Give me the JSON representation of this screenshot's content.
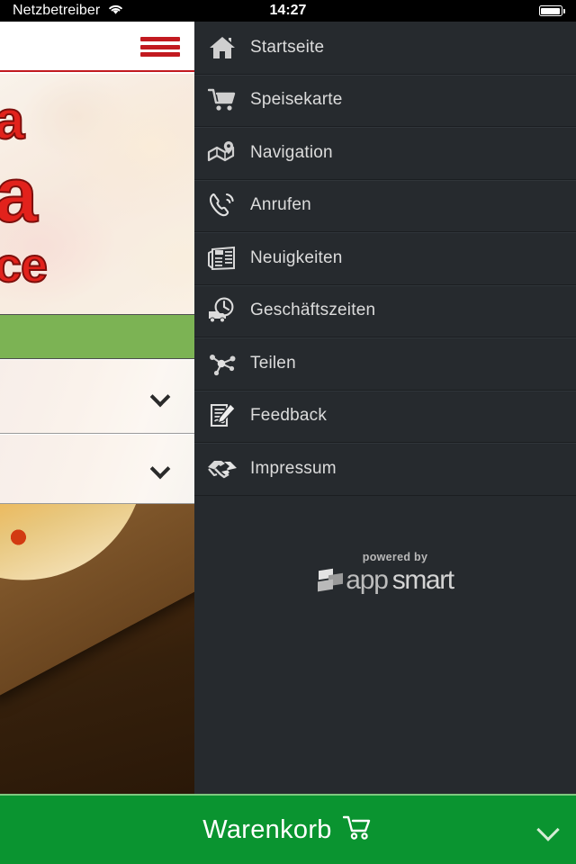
{
  "status_bar": {
    "carrier": "Netzbetreiber",
    "wifi_icon": "wifi-icon",
    "time": "14:27",
    "battery_icon": "battery-full-icon"
  },
  "background_app": {
    "menu_toggle_icon": "hamburger-menu-icon",
    "hero_text_lines": [
      "a",
      "a",
      "ce"
    ],
    "list_rows": [
      {
        "chevron_icon": "chevron-right-icon"
      },
      {
        "chevron_icon": "chevron-right-icon"
      }
    ]
  },
  "drawer": {
    "items": [
      {
        "label": "Startseite",
        "icon": "home-icon"
      },
      {
        "label": "Speisekarte",
        "icon": "shopping-cart-icon"
      },
      {
        "label": "Navigation",
        "icon": "map-pin-icon"
      },
      {
        "label": "Anrufen",
        "icon": "phone-icon"
      },
      {
        "label": "Neuigkeiten",
        "icon": "newspaper-icon"
      },
      {
        "label": "Geschäftszeiten",
        "icon": "clock-truck-icon"
      },
      {
        "label": "Teilen",
        "icon": "share-nodes-icon"
      },
      {
        "label": "Feedback",
        "icon": "clipboard-pencil-icon"
      },
      {
        "label": "Impressum",
        "icon": "handshake-icon"
      }
    ],
    "branding": {
      "powered_by": "powered by",
      "name_first": "app",
      "name_second": "smart",
      "logo_icon": "appsmart-logo-icon"
    }
  },
  "bottom_bar": {
    "label": "Warenkorb",
    "cart_icon": "shopping-cart-icon",
    "arrow_icon": "chevron-right-icon"
  },
  "colors": {
    "drawer_bg": "#262a2e",
    "drawer_text": "#dcdcdc",
    "accent_red": "#c21a20",
    "band_green": "#7cb354",
    "cart_green": "#0a9430",
    "status_bg": "#000000"
  }
}
